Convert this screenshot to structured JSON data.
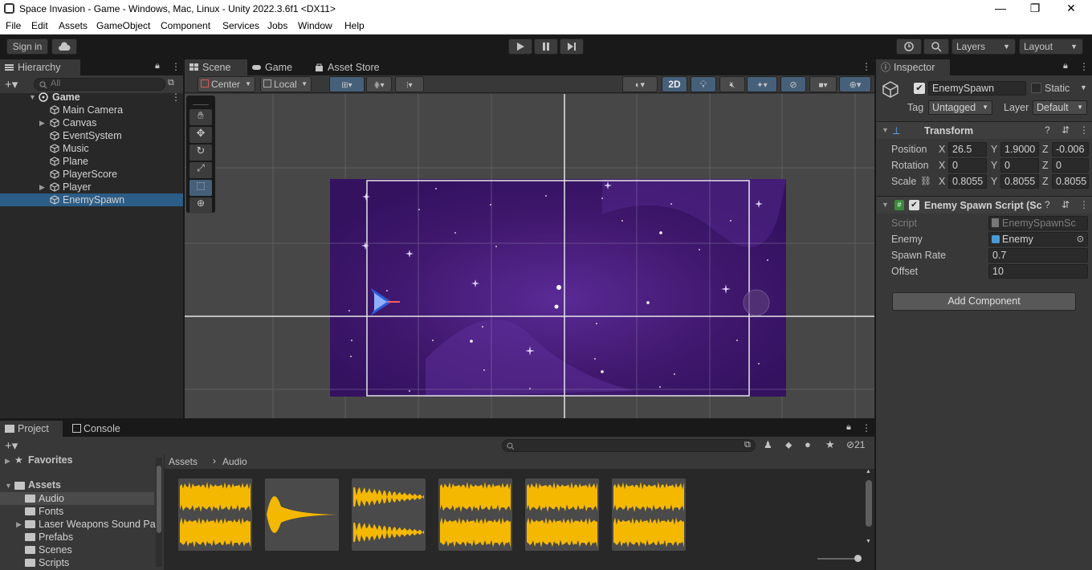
{
  "window": {
    "title": "Space Invasion - Game - Windows, Mac, Linux - Unity 2022.3.6f1 <DX11>",
    "controls": [
      "—",
      "❐",
      "✕"
    ]
  },
  "menu": [
    "File",
    "Edit",
    "Assets",
    "GameObject",
    "Component",
    "Services",
    "Jobs",
    "Window",
    "Help"
  ],
  "toolbar": {
    "sign_in": "Sign in",
    "layers": "Layers",
    "layout": "Layout"
  },
  "hierarchy": {
    "tab": "Hierarchy",
    "search_placeholder": "All",
    "scene": "Game",
    "items": [
      {
        "label": "Main Camera",
        "expandable": false,
        "selected": false
      },
      {
        "label": "Canvas",
        "expandable": true,
        "selected": false
      },
      {
        "label": "EventSystem",
        "expandable": false,
        "selected": false
      },
      {
        "label": "Music",
        "expandable": false,
        "selected": false
      },
      {
        "label": "Plane",
        "expandable": false,
        "selected": false
      },
      {
        "label": "PlayerScore",
        "expandable": false,
        "selected": false
      },
      {
        "label": "Player",
        "expandable": true,
        "selected": false
      },
      {
        "label": "EnemySpawn",
        "expandable": false,
        "selected": true
      }
    ]
  },
  "scene_view": {
    "tabs": [
      "Scene",
      "Game",
      "Asset Store"
    ],
    "pivot": "Center",
    "space": "Local",
    "mode_2d": "2D"
  },
  "inspector": {
    "tab": "Inspector",
    "object_name": "EnemySpawn",
    "static_label": "Static",
    "tag_label": "Tag",
    "tag": "Untagged",
    "layer_label": "Layer",
    "layer": "Default",
    "transform": {
      "title": "Transform",
      "position_label": "Position",
      "rotation_label": "Rotation",
      "scale_label": "Scale",
      "position": {
        "x": "26.5",
        "y": "1.9000",
        "z": "-0.006"
      },
      "rotation": {
        "x": "0",
        "y": "0",
        "z": "0"
      },
      "scale": {
        "x": "0.8055",
        "y": "0.8055",
        "z": "0.8055"
      }
    },
    "script_component": {
      "title": "Enemy Spawn Script (Sc",
      "script_label": "Script",
      "script_value": "EnemySpawnSc",
      "enemy_label": "Enemy",
      "enemy_value": "Enemy",
      "spawn_rate_label": "Spawn Rate",
      "spawn_rate_value": "0.7",
      "offset_label": "Offset",
      "offset_value": "10"
    },
    "add_component": "Add Component"
  },
  "project": {
    "tabs": [
      "Project",
      "Console"
    ],
    "favorites": "Favorites",
    "assets": "Assets",
    "folders": [
      {
        "label": "Audio",
        "selected": true,
        "expandable": false
      },
      {
        "label": "Fonts",
        "selected": false,
        "expandable": false
      },
      {
        "label": "Laser Weapons Sound Pa",
        "selected": false,
        "expandable": true
      },
      {
        "label": "Prefabs",
        "selected": false,
        "expandable": false
      },
      {
        "label": "Scenes",
        "selected": false,
        "expandable": false
      },
      {
        "label": "Scripts",
        "selected": false,
        "expandable": false
      }
    ],
    "breadcrumb": [
      "Assets",
      "Audio"
    ],
    "hidden_count": "21"
  },
  "colors": {
    "accent": "#2c5d87",
    "waveform": "#f5b800",
    "space_bg": "#3b1466"
  }
}
